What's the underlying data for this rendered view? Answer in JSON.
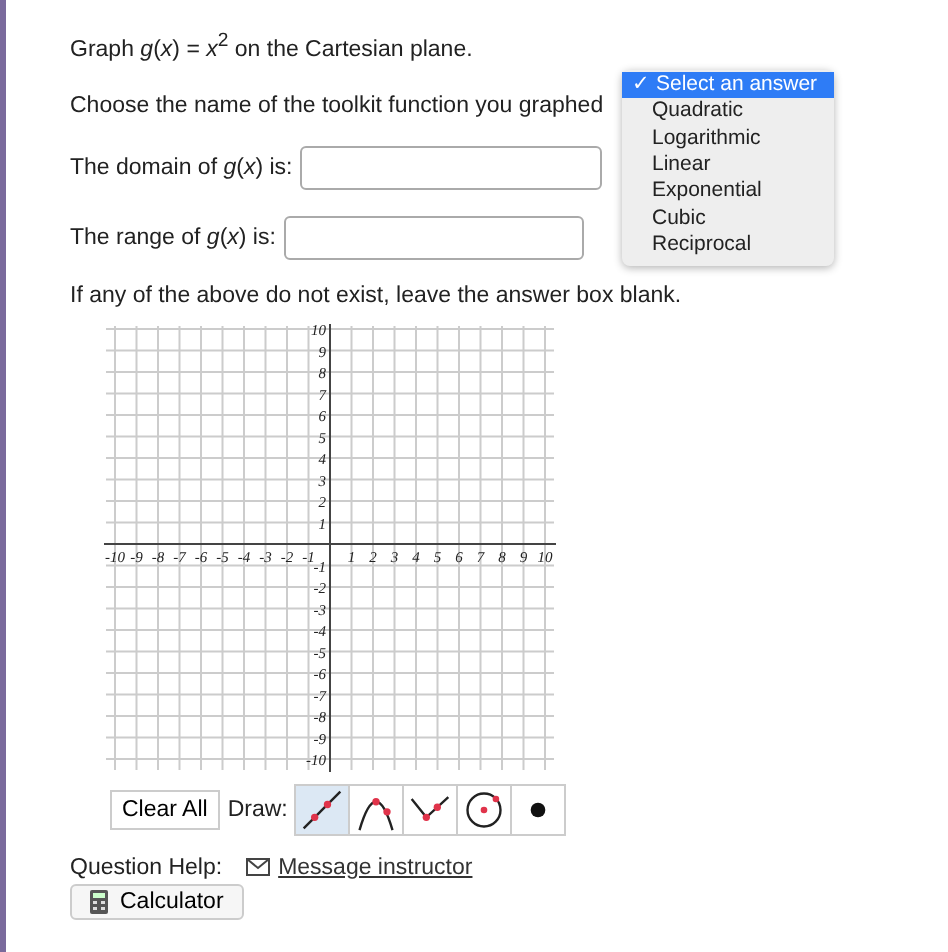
{
  "prompt": "Graph *g*(*x*) = *x*$^{2}$ on the Cartesian plane.",
  "toolkit_question": {
    "label": "Choose the name of the toolkit function you graphed",
    "options": [
      {
        "label": "Select an answer",
        "selected": true
      },
      {
        "label": "Quadratic",
        "selected": false
      },
      {
        "label": "Logarithmic",
        "selected": false
      },
      {
        "label": "Linear",
        "selected": false
      },
      {
        "label": "Exponential",
        "selected": false
      },
      {
        "label": "Cubic",
        "selected": false
      },
      {
        "label": "Reciprocal",
        "selected": false
      }
    ],
    "check_mark": "✓"
  },
  "domain": {
    "label": "The domain of *g*(*x*) is:"
  },
  "range": {
    "label": "The range of *g*(*x*) is:"
  },
  "note": "If any of the above do not exist, leave the answer box blank.",
  "graph": {
    "x_labels": [
      "-10",
      "-9",
      "-8",
      "-7",
      "-6",
      "-5",
      "-4",
      "-3",
      "-2",
      "-1",
      "1",
      "2",
      "3",
      "4",
      "5",
      "6",
      "7",
      "8",
      "9",
      "10"
    ],
    "y_labels": [
      "10",
      "9",
      "8",
      "7",
      "6",
      "5",
      "4",
      "3",
      "2",
      "1",
      "-1",
      "-2",
      "-3",
      "-4",
      "-5",
      "-6",
      "-7",
      "-8",
      "-9",
      "-10"
    ]
  },
  "clear_button": "Clear All",
  "draw_label": "Draw:",
  "draw_tools": [
    {
      "kind": "line",
      "selected": true
    },
    {
      "kind": "parabola",
      "selected": false
    },
    {
      "kind": "absolute",
      "selected": false
    },
    {
      "kind": "circle",
      "selected": false
    },
    {
      "kind": "point",
      "selected": false
    }
  ],
  "help_label": "Question Help:",
  "help_link": "Message instructor",
  "calculator_button": "Calculator"
}
